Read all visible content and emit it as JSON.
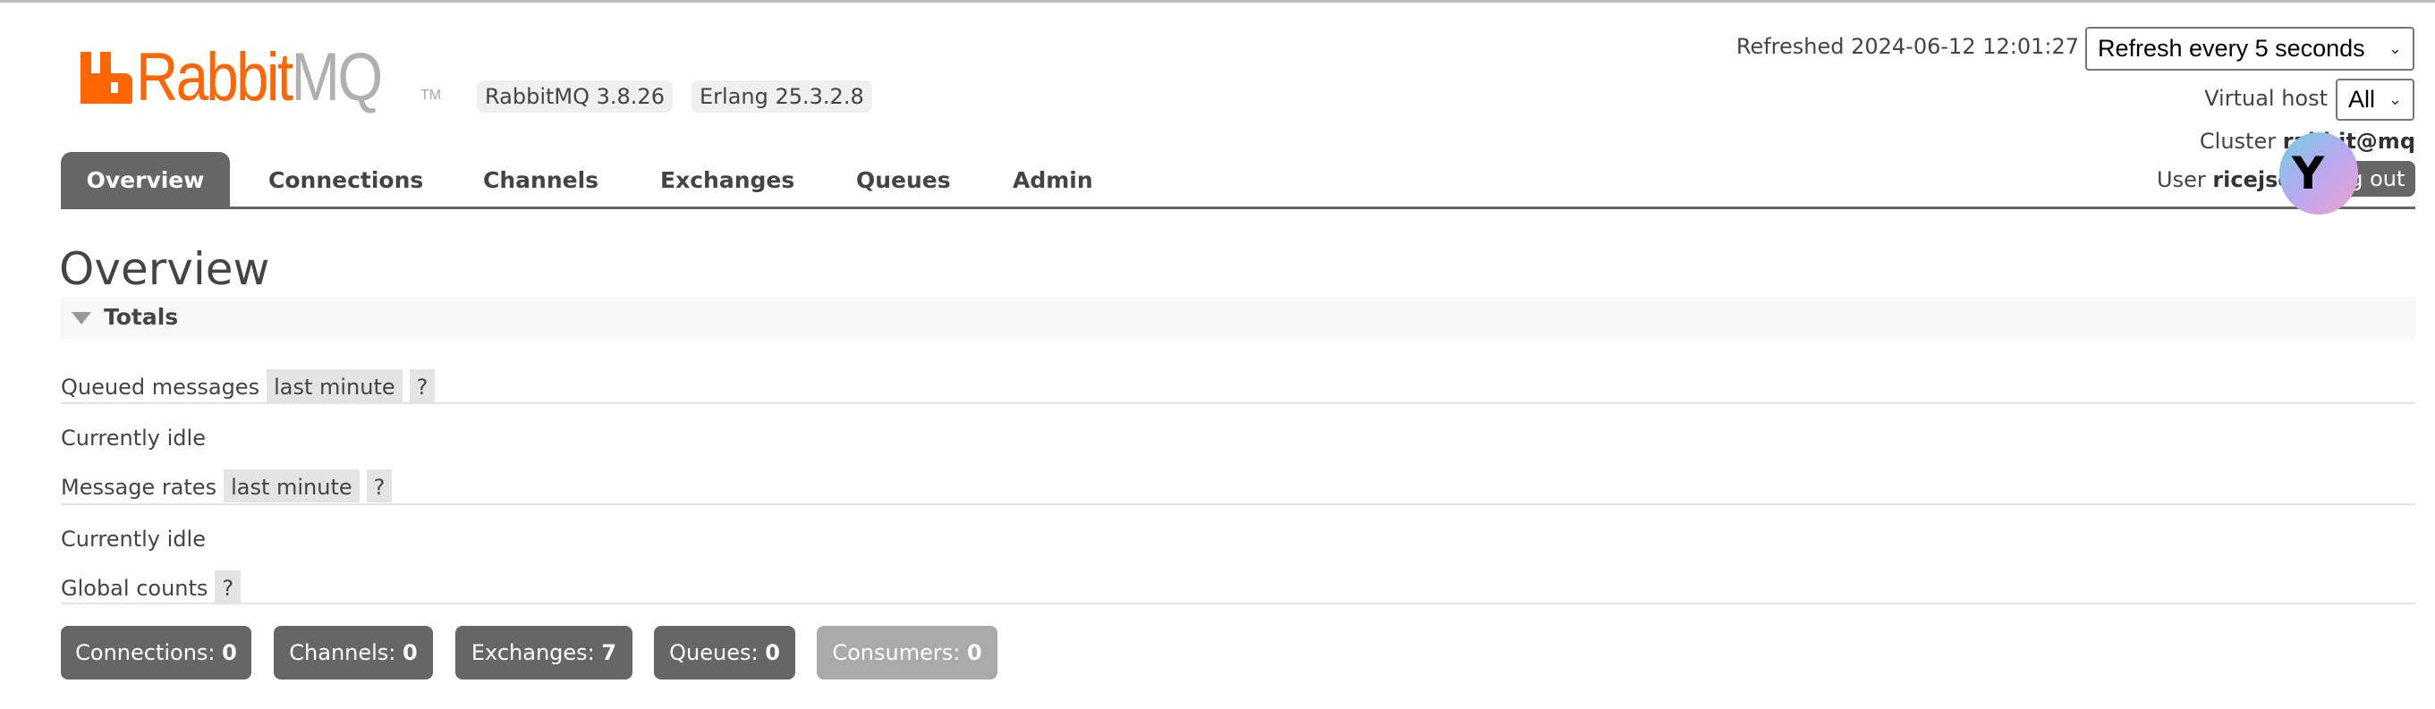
{
  "logo": {
    "part1": "Rabbit",
    "part2": "MQ",
    "tm": "TM"
  },
  "versions": {
    "rabbitmq": "RabbitMQ 3.8.26",
    "erlang": "Erlang 25.3.2.8"
  },
  "tabs": [
    {
      "label": "Overview",
      "active": true
    },
    {
      "label": "Connections"
    },
    {
      "label": "Channels"
    },
    {
      "label": "Exchanges"
    },
    {
      "label": "Queues"
    },
    {
      "label": "Admin"
    }
  ],
  "header_right": {
    "refreshed": "Refreshed 2024-06-12 12:01:27",
    "refresh_select": "Refresh every 5 seconds",
    "vhost_label": "Virtual host",
    "vhost_select": "All",
    "cluster_label": "Cluster",
    "cluster_name": "rabbit@mq",
    "user_label": "User",
    "user_name": "ricejson",
    "logout": "Log out"
  },
  "page": {
    "title": "Overview",
    "section": "Totals",
    "queued_label": "Queued messages",
    "queued_range": "last minute",
    "help": "?",
    "queued_status": "Currently idle",
    "rates_label": "Message rates",
    "rates_range": "last minute",
    "rates_status": "Currently idle",
    "global_label": "Global counts"
  },
  "counts": [
    {
      "label": "Connections:",
      "value": "0"
    },
    {
      "label": "Channels:",
      "value": "0"
    },
    {
      "label": "Exchanges:",
      "value": "7"
    },
    {
      "label": "Queues:",
      "value": "0"
    },
    {
      "label": "Consumers:",
      "value": "0",
      "disabled": true
    }
  ],
  "colors": {
    "brand": "#ff6600",
    "tab_active": "#666666",
    "chip": "#e4e4e4"
  }
}
